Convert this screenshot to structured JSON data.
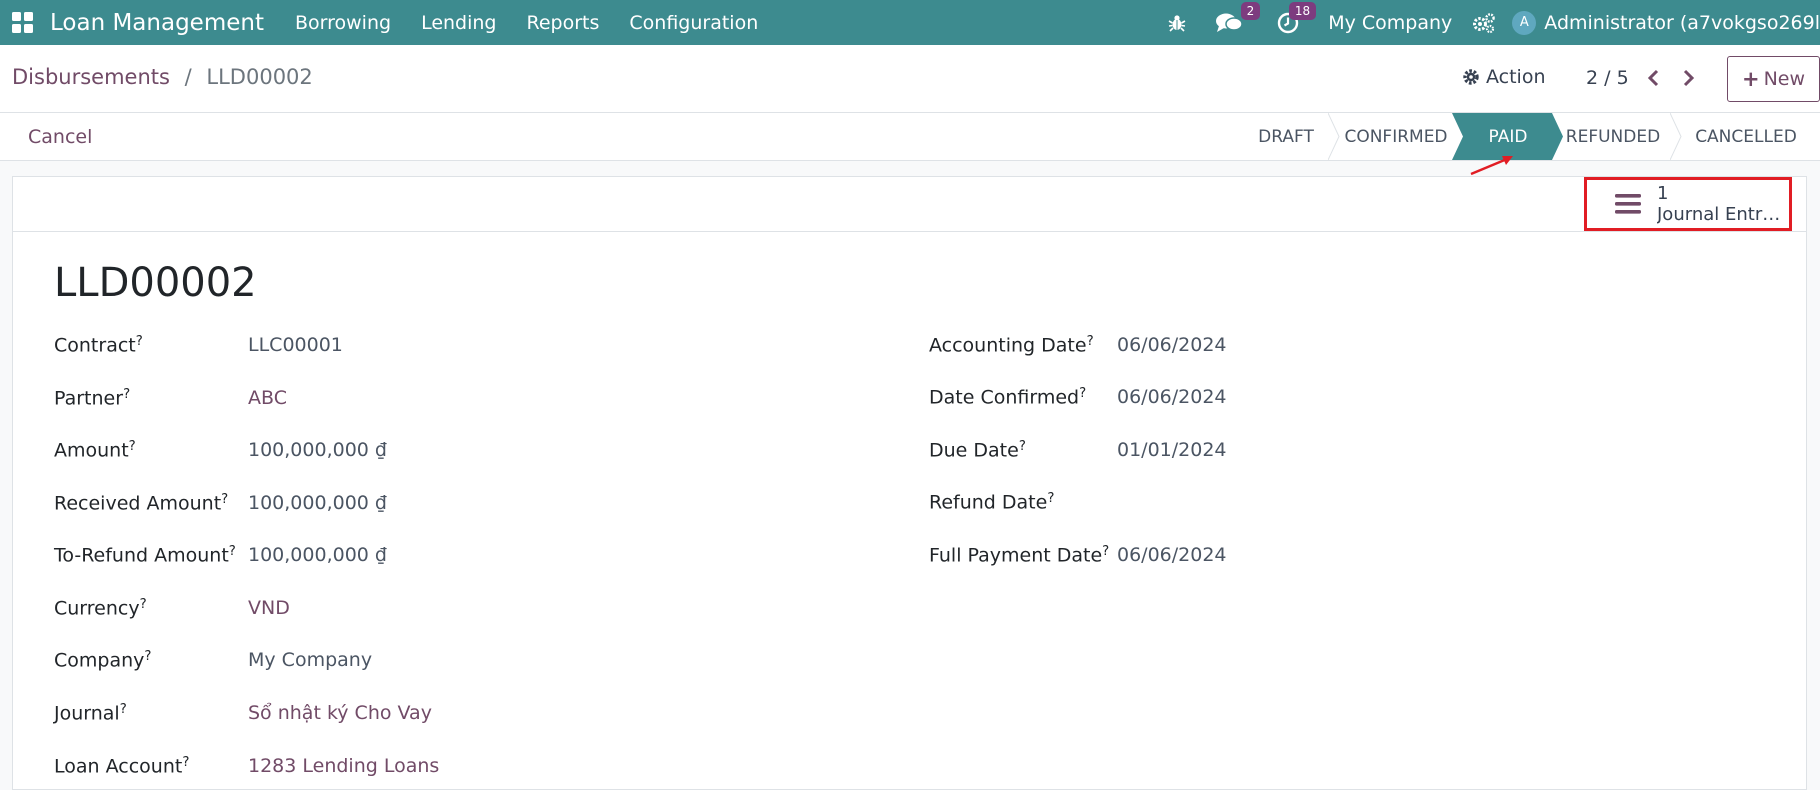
{
  "navbar": {
    "app_name": "Loan Management",
    "menu": [
      "Borrowing",
      "Lending",
      "Reports",
      "Configuration"
    ],
    "messages_count": "2",
    "activities_count": "18",
    "company": "My Company",
    "avatar_letter": "A",
    "user": "Administrator (a7vokgso269l"
  },
  "control": {
    "breadcrumb_parent": "Disbursements",
    "breadcrumb_sep": "/",
    "breadcrumb_current": "LLD00002",
    "action_label": "Action",
    "pager": "2 / 5",
    "new_label": "New"
  },
  "statusbar": {
    "cancel_label": "Cancel",
    "stages": [
      "DRAFT",
      "CONFIRMED",
      "PAID",
      "REFUNDED",
      "CANCELLED"
    ],
    "active_stage": "PAID"
  },
  "smart_button": {
    "count": "1",
    "label": "Journal Entri…"
  },
  "record": {
    "title": "LLD00002",
    "left_fields": [
      {
        "label": "Contract",
        "value": "LLC00001",
        "link": false
      },
      {
        "label": "Partner",
        "value": "ABC",
        "link": true
      },
      {
        "label": "Amount",
        "value": "100,000,000 ₫",
        "link": false
      },
      {
        "label": "Received Amount",
        "value": "100,000,000 ₫",
        "link": false
      },
      {
        "label": "To-Refund Amount",
        "value": "100,000,000 ₫",
        "link": false
      },
      {
        "label": "Currency",
        "value": "VND",
        "link": true
      },
      {
        "label": "Company",
        "value": "My Company",
        "link": false
      },
      {
        "label": "Journal",
        "value": "Sổ nhật ký Cho Vay",
        "link": true
      },
      {
        "label": "Loan Account",
        "value": "1283 Lending Loans",
        "link": true
      }
    ],
    "right_fields": [
      {
        "label": "Accounting Date",
        "value": "06/06/2024"
      },
      {
        "label": "Date Confirmed",
        "value": "06/06/2024"
      },
      {
        "label": "Due Date",
        "value": "01/01/2024"
      },
      {
        "label": "Refund Date",
        "value": ""
      },
      {
        "label": "Full Payment Date",
        "value": "06/06/2024"
      }
    ],
    "help_mark": "?"
  },
  "colors": {
    "navbar": "#3d8b8f",
    "active_stage": "#3d8b8f",
    "brand": "#714b67",
    "highlight": "#e11d24"
  }
}
